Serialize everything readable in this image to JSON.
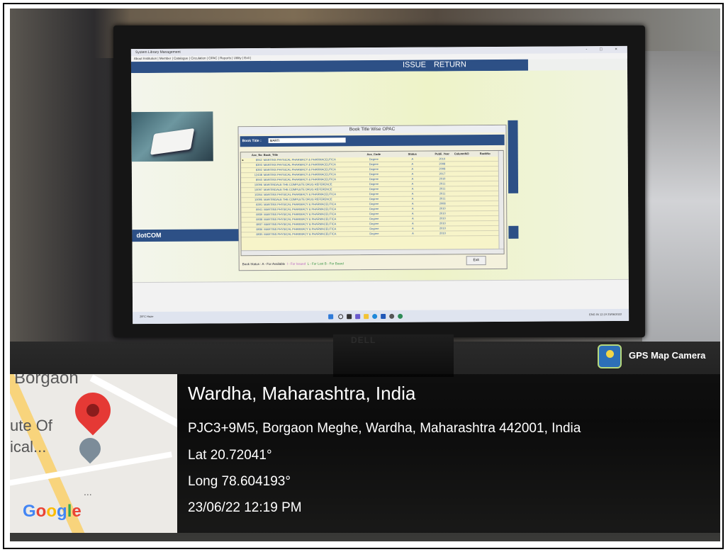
{
  "app": {
    "window_title": "System     Library Management",
    "menu": "About Institution | Member | Catalogue | Circulation | OPAC | Reports | Utility | Exit |",
    "window_controls": "- □ ×",
    "nav": {
      "issue": "ISSUE",
      "return": "RETURN"
    },
    "logo_text": "dotCOM"
  },
  "opac": {
    "title": "Book Title Wise OPAC",
    "search_label": "Book Title :",
    "search_value": "MARTI",
    "columns": [
      "Acc_No",
      "Book_Title",
      "Acc_Code",
      "Status",
      "Publi_Year",
      "ColumnNO",
      "RackNo"
    ],
    "rows": [
      [
        "8942",
        "MARTINS PHYSICAL PHARMACY & PHARMACEUTICA",
        "Degree",
        "A",
        "2010",
        "",
        ""
      ],
      [
        "8393",
        "MARTINS PHYSICAL PHARMACY & PHARMACEUTICA",
        "Degree",
        "A",
        "2008",
        "",
        ""
      ],
      [
        "8392",
        "MARTINS PHYSICAL PHARMACY & PHARMACEUTICA",
        "Degree",
        "A",
        "2008",
        "",
        ""
      ],
      [
        "12438",
        "MARTINS PHYSICAL PHARMACY & PHARMACEUTICA",
        "Degree",
        "A",
        "2017",
        "",
        ""
      ],
      [
        "8940",
        "MARTINS PHYSICAL PHARMACY & PHARMACEUTICA",
        "Degree",
        "A",
        "2010",
        "",
        ""
      ],
      [
        "10096",
        "MARTINDALE THE COMPLETE DRUG REFERENCE",
        "Degree",
        "A",
        "2011",
        "",
        ""
      ],
      [
        "10097",
        "MARTINDALE THE COMPLETE DRUG REFERENCE",
        "Degree",
        "A",
        "2011",
        "",
        ""
      ],
      [
        "10264",
        "MARTINS PHYSICAL PHARMACY & PHARMACEUTICA",
        "Degree",
        "A",
        "2011",
        "",
        ""
      ],
      [
        "10095",
        "MARTINDALE THE COMPLETE DRUG REFERENCE",
        "Degree",
        "A",
        "2011",
        "",
        ""
      ],
      [
        "8391",
        "MARTINS PHYSICAL PHARMACY & PHARMACEUTICA",
        "Degree",
        "A",
        "2008",
        "",
        ""
      ],
      [
        "8941",
        "MARTINS PHYSICAL PHARMACY & PHARMACEUTICA",
        "Degree",
        "A",
        "2010",
        "",
        ""
      ],
      [
        "8939",
        "MARTINS PHYSICAL PHARMACY & PHARMACEUTICA",
        "Degree",
        "A",
        "2010",
        "",
        ""
      ],
      [
        "8938",
        "MARTINS PHYSICAL PHARMACY & PHARMACEUTICA",
        "Degree",
        "A",
        "2010",
        "",
        ""
      ],
      [
        "8937",
        "MARTINS PHYSICAL PHARMACY & PHARMACEUTICA",
        "Degree",
        "A",
        "2010",
        "",
        ""
      ],
      [
        "8936",
        "MARTINS PHYSICAL PHARMACY & PHARMACEUTICA",
        "Degree",
        "A",
        "2010",
        "",
        ""
      ],
      [
        "8935",
        "MARTINS PHYSICAL PHARMACY & PHARMACEUTICA",
        "Degree",
        "A",
        "2010",
        "",
        ""
      ]
    ],
    "status_text_a": "Book Status : A - For Available",
    "status_text_b": "I - For Issued",
    "status_text_c": "L - For Lost  B - For Board",
    "exit_label": "Exit"
  },
  "taskbar": {
    "weather": "28°C Haze",
    "tray": "ENG IN  12:19 23/06/2022"
  },
  "monitor_brand": "DELL",
  "gps": {
    "app_label": "GPS Map Camera",
    "city": "Wardha, Maharashtra, India",
    "address": "PJC3+9M5, Borgaon Meghe, Wardha, Maharashtra 442001, India",
    "lat": "Lat 20.72041°",
    "long": "Long 78.604193°",
    "datetime": "23/06/22 12:19 PM"
  },
  "map": {
    "town": "Borgaon",
    "place_line1": "ute Of",
    "place_line2": "ical...",
    "google": "Google"
  },
  "colors": {
    "app_blue": "#2d5086",
    "grid_bg": "#f7f4c9",
    "grid_text": "#2e5aa8",
    "pin_red": "#e53935"
  }
}
